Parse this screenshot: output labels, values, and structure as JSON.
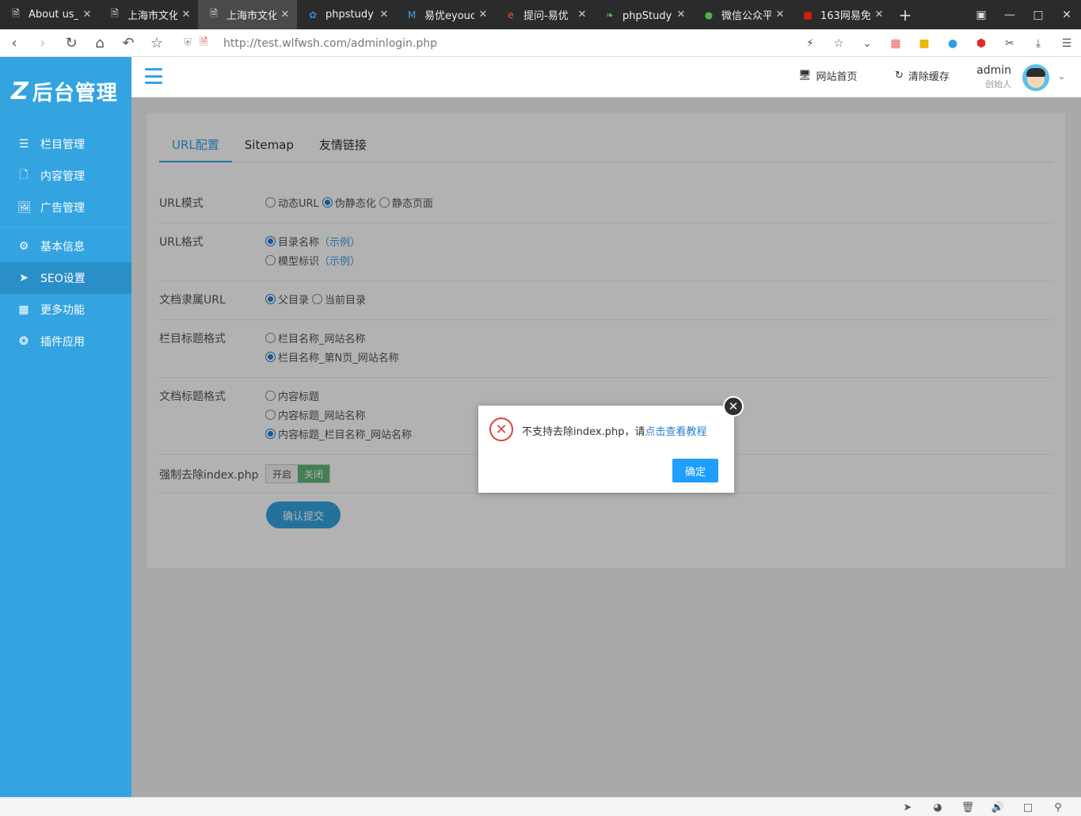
{
  "browser": {
    "tabs": [
      {
        "title": "About us_(",
        "icon": "doc",
        "icon_color": "#eeeeee"
      },
      {
        "title": "上海市文化",
        "icon": "doc",
        "icon_color": "#eeeeee"
      },
      {
        "title": "上海市文化",
        "icon": "doc",
        "icon_color": "#eeeeee",
        "active": true
      },
      {
        "title": "phpstudy",
        "icon": "paw",
        "icon_color": "#3b83e0"
      },
      {
        "title": "易优eyouc",
        "icon": "M",
        "icon_color": "#3aa0e8"
      },
      {
        "title": "提问-易优",
        "icon": "e",
        "icon_color": "#e8612a"
      },
      {
        "title": "phpStudy安",
        "icon": "leaf",
        "icon_color": "#5cb85c"
      },
      {
        "title": "微信公众平",
        "icon": "wechat",
        "icon_color": "#44b549"
      },
      {
        "title": "163网易免",
        "icon": "163",
        "icon_color": "#d81e06"
      }
    ],
    "url": "http://test.wlfwsh.com/adminlogin.php"
  },
  "sidebar": {
    "logo_text": "后台管理",
    "logo_mark": "Z",
    "group1": [
      {
        "label": "栏目管理",
        "icon": "list-icon"
      },
      {
        "label": "内容管理",
        "icon": "file-icon"
      },
      {
        "label": "广告管理",
        "icon": "image-file-icon"
      }
    ],
    "group2": [
      {
        "label": "基本信息",
        "icon": "gear-icon"
      },
      {
        "label": "SEO设置",
        "icon": "send-icon",
        "active": true
      },
      {
        "label": "更多功能",
        "icon": "grid-icon"
      },
      {
        "label": "插件应用",
        "icon": "plugin-icon"
      }
    ]
  },
  "topbar": {
    "home_label": "网站首页",
    "clear_cache_label": "清除缓存",
    "user_name": "admin",
    "user_role": "创始人"
  },
  "tabs": [
    "URL配置",
    "Sitemap",
    "友情链接"
  ],
  "form": {
    "url_mode": {
      "label": "URL模式",
      "options": [
        "动态URL",
        "伪静态化",
        "静态页面"
      ],
      "selected": 1
    },
    "url_format": {
      "label": "URL格式",
      "options": [
        "目录名称",
        "模型标识"
      ],
      "example": "（示例）",
      "selected": 0
    },
    "doc_url": {
      "label": "文档隶属URL",
      "options": [
        "父目录",
        "当前目录"
      ],
      "selected": 0
    },
    "column_title": {
      "label": "栏目标题格式",
      "options": [
        "栏目名称_网站名称",
        "栏目名称_第N页_网站名称"
      ],
      "selected": 1
    },
    "doc_title": {
      "label": "文档标题格式",
      "options": [
        "内容标题",
        "内容标题_网站名称",
        "内容标题_栏目名称_网站名称"
      ],
      "selected": 2
    },
    "force_remove": {
      "label": "强制去除index.php",
      "on_label": "开启",
      "off_label": "关闭"
    },
    "submit_label": "确认提交"
  },
  "dialog": {
    "message": "不支持去除index.php，请",
    "link_text": "点击查看教程",
    "ok_label": "确定"
  }
}
